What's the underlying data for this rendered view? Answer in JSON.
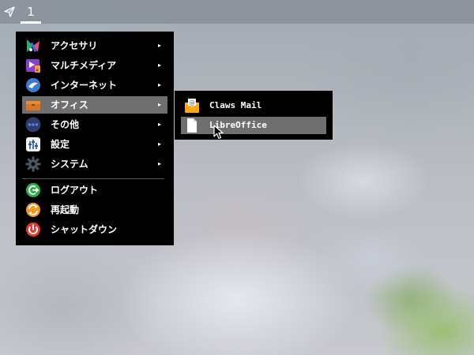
{
  "panel": {
    "launcher_icon": "paper-plane-icon",
    "workspace": "1"
  },
  "menu": {
    "items": [
      {
        "label": "アクセサリ",
        "icon": "accessories-icon",
        "arrow": "▸"
      },
      {
        "label": "マルチメディア",
        "icon": "multimedia-icon",
        "arrow": "▸"
      },
      {
        "label": "インターネット",
        "icon": "internet-icon",
        "arrow": "▸"
      },
      {
        "label": "オフィス",
        "icon": "office-icon",
        "arrow": "▸"
      },
      {
        "label": "その他",
        "icon": "other-icon",
        "arrow": "▸"
      },
      {
        "label": "設定",
        "icon": "settings-icon",
        "arrow": "▸"
      },
      {
        "label": "システム",
        "icon": "system-icon",
        "arrow": "▸"
      },
      {
        "label": "ログアウト",
        "icon": "logout-icon"
      },
      {
        "label": "再起動",
        "icon": "reboot-icon"
      },
      {
        "label": "シャットダウン",
        "icon": "shutdown-icon"
      }
    ],
    "active_item": "オフィス"
  },
  "submenu": {
    "items": [
      {
        "label": "Claws Mail",
        "icon": "mail-icon"
      },
      {
        "label": "LibreOffice",
        "icon": "document-icon"
      }
    ],
    "active_item": "LibreOffice"
  },
  "colors": {
    "menu_bg": "#000000",
    "highlight": "#6f6f6f",
    "text": "#ffffff"
  }
}
